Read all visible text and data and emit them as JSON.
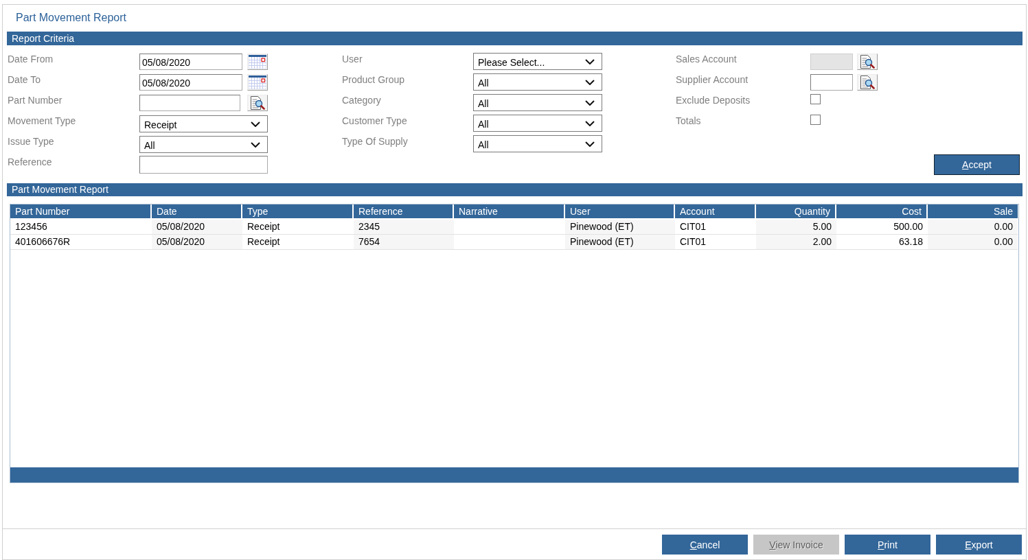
{
  "page_title": "Part Movement Report",
  "criteria": {
    "title": "Report Criteria",
    "columns": [
      {
        "fields": [
          {
            "kind": "date",
            "label": "Date From",
            "value": "05/08/2020",
            "disabled": false
          },
          {
            "kind": "date",
            "label": "Date To",
            "value": "05/08/2020",
            "disabled": false
          },
          {
            "kind": "lookup",
            "label": "Part Number",
            "disabled": false
          },
          {
            "kind": "dropdown",
            "label": "Movement Type",
            "value": "Receipt",
            "disabled": false
          },
          {
            "kind": "dropdown",
            "label": "Issue Type",
            "value": "All",
            "disabled": false
          },
          {
            "kind": "text",
            "label": "Reference",
            "disabled": false
          }
        ]
      },
      {
        "fields": [
          {
            "kind": "dropdown",
            "label": "User",
            "value": "Please Select...",
            "disabled": false
          },
          {
            "kind": "dropdown",
            "label": "Product Group",
            "value": "All",
            "disabled": false
          },
          {
            "kind": "dropdown",
            "label": "Category",
            "value": "All",
            "disabled": false
          },
          {
            "kind": "dropdown",
            "label": "Customer Type",
            "value": "All",
            "disabled": false
          },
          {
            "kind": "dropdown",
            "label": "Type Of Supply",
            "value": "All",
            "disabled": false
          }
        ]
      },
      {
        "fields": [
          {
            "kind": "lookup",
            "label": "Sales Account",
            "disabled": true
          },
          {
            "kind": "lookup",
            "label": "Supplier Account",
            "disabled": false
          },
          {
            "kind": "checkbox",
            "label": "Exclude Deposits",
            "checked": false,
            "disabled": false
          },
          {
            "kind": "checkbox",
            "label": "Totals",
            "checked": false,
            "disabled": false
          }
        ]
      }
    ],
    "accept_button": {
      "label": "Accept"
    }
  },
  "report": {
    "title": "Part Movement Report",
    "columns": [
      {
        "label": "Part Number",
        "kind": "text"
      },
      {
        "label": "Date",
        "kind": "text"
      },
      {
        "label": "Type",
        "kind": "text"
      },
      {
        "label": "Reference",
        "kind": "text"
      },
      {
        "label": "Narrative",
        "kind": "text"
      },
      {
        "label": "User",
        "kind": "text"
      },
      {
        "label": "Account",
        "kind": "text"
      },
      {
        "label": "Quantity",
        "kind": "number"
      },
      {
        "label": "Cost",
        "kind": "number"
      },
      {
        "label": "Sale",
        "kind": "number"
      }
    ],
    "rows": [
      [
        "123456",
        "05/08/2020",
        "Receipt",
        "2345",
        null,
        "Pinewood (ET)",
        "CIT01",
        "5.00",
        "500.00",
        "0.00"
      ],
      [
        "401606676R",
        "05/08/2020",
        "Receipt",
        "7654",
        null,
        "Pinewood (ET)",
        "CIT01",
        "2.00",
        "63.18",
        "0.00"
      ]
    ]
  },
  "buttons": [
    {
      "label": "Cancel",
      "disabled": false
    },
    {
      "label": "View Invoice",
      "disabled": true
    },
    {
      "label": "Print",
      "disabled": false
    },
    {
      "label": "Export",
      "disabled": false
    }
  ]
}
